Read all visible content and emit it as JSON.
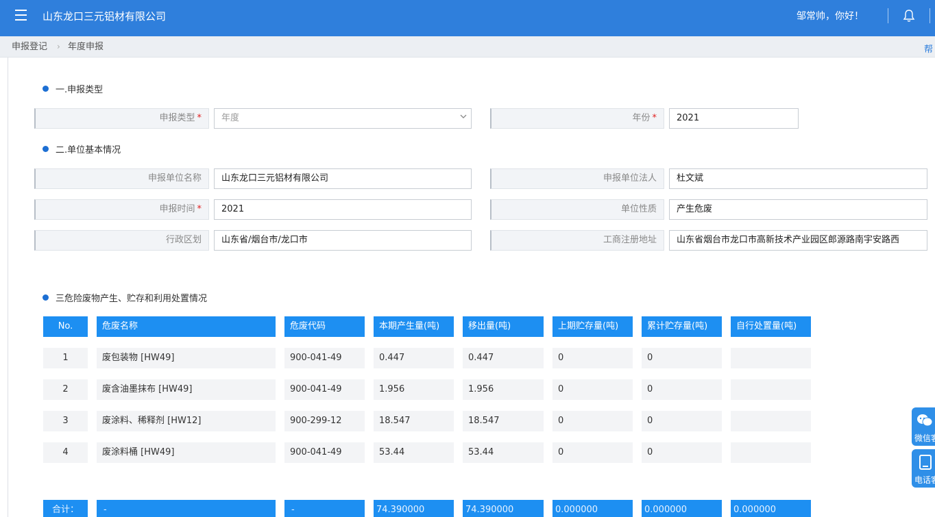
{
  "header": {
    "app_title": "山东龙口三元铝材有限公司",
    "greeting": "邹常帅，你好！"
  },
  "breadcrumb": {
    "items": [
      "申报登记",
      "年度申报"
    ],
    "separator": "›",
    "help": "帮"
  },
  "section1": {
    "title": "一.申报类型",
    "type_label": "申报类型",
    "type_value": "年度",
    "year_label": "年份",
    "year_value": "2021",
    "required_mark": "*"
  },
  "section2": {
    "title": "二.单位基本情况",
    "unit_name_label": "申报单位名称",
    "unit_name_value": "山东龙口三元铝材有限公司",
    "legal_person_label": "申报单位法人",
    "legal_person_value": "杜文斌",
    "time_label": "申报时间",
    "time_value": "2021",
    "nature_label": "单位性质",
    "nature_value": "产生危废",
    "region_label": "行政区划",
    "region_value": "山东省/烟台市/龙口市",
    "address_label": "工商注册地址",
    "address_value": "山东省烟台市龙口市高新技术产业园区郎源路南宇安路西"
  },
  "section3": {
    "title": "三危险废物产生、贮存和利用处置情况",
    "columns": [
      "No.",
      "危废名称",
      "危废代码",
      "本期产生量(吨)",
      "移出量(吨)",
      "上期贮存量(吨)",
      "累计贮存量(吨)",
      "自行处置量(吨)"
    ],
    "rows": [
      [
        "1",
        "废包装物 [HW49]",
        "900-041-49",
        "0.447",
        "0.447",
        "0",
        "0",
        ""
      ],
      [
        "2",
        "废含油墨抹布 [HW49]",
        "900-041-49",
        "1.956",
        "1.956",
        "0",
        "0",
        ""
      ],
      [
        "3",
        "废涂料、稀释剂 [HW12]",
        "900-299-12",
        "18.547",
        "18.547",
        "0",
        "0",
        ""
      ],
      [
        "4",
        "废涂料桶 [HW49]",
        "900-041-49",
        "53.44",
        "53.44",
        "0",
        "0",
        ""
      ]
    ],
    "totals": [
      "合计：",
      "-",
      "-",
      "74.390000",
      "74.390000",
      "0.000000",
      "0.000000",
      "0.000000"
    ]
  },
  "side": {
    "wechat": "微信客服",
    "phone": "电话客服"
  },
  "colors": {
    "topbar": "#2f7fdc",
    "table_header": "#1d8ff2",
    "required": "#e02020"
  },
  "icons": [
    "menu-icon",
    "bell-icon",
    "chevron-down-icon",
    "wechat-icon",
    "phone-icon"
  ]
}
